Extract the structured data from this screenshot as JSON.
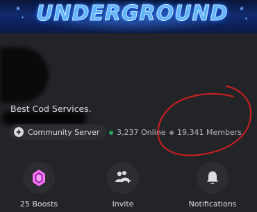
{
  "banner": {
    "title": "UNDERGROUND"
  },
  "server": {
    "description": "Best Cod Services.",
    "type_label": "Community Server",
    "online": "3,237 Online",
    "members": "19,341 Members"
  },
  "colors": {
    "online": "#23a55a",
    "members": "#80848e",
    "boost": "#ff73fa",
    "annotation": "#d21f1f"
  },
  "actions": [
    {
      "label": "25 Boosts",
      "icon": "boost-gem-icon"
    },
    {
      "label": "Invite",
      "icon": "add-person-icon"
    },
    {
      "label": "Notifications",
      "icon": "bell-icon"
    }
  ]
}
